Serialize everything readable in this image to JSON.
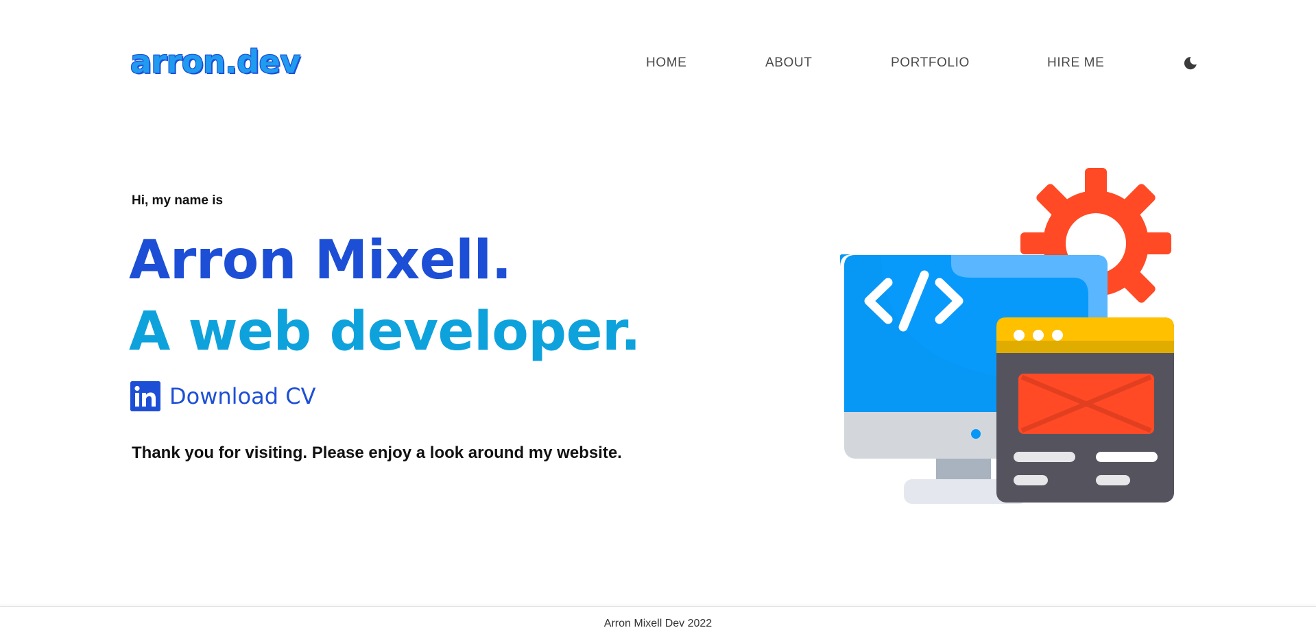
{
  "header": {
    "logo": "arron.dev",
    "nav": {
      "home": "HOME",
      "about": "ABOUT",
      "portfolio": "PORTFOLIO",
      "hire_me": "HIRE ME"
    },
    "theme_toggle_icon": "moon-icon"
  },
  "hero": {
    "greeting": "Hi, my name is",
    "name": "Arron Mixell.",
    "role": "A web developer.",
    "cv_icon": "linkedin-icon",
    "cv_label": "Download CV",
    "message": "Thank you for visiting. Please enjoy a look around my website."
  },
  "footer": {
    "text": "Arron Mixell Dev 2022"
  },
  "colors": {
    "primary": "#1d4fd6",
    "secondary": "#0ea2dd",
    "nav_text": "#4a4a4a",
    "gear": "#ff4a25",
    "monitor": "#0797f5",
    "browser_bar": "#ffc000",
    "browser_body": "#55545e"
  }
}
